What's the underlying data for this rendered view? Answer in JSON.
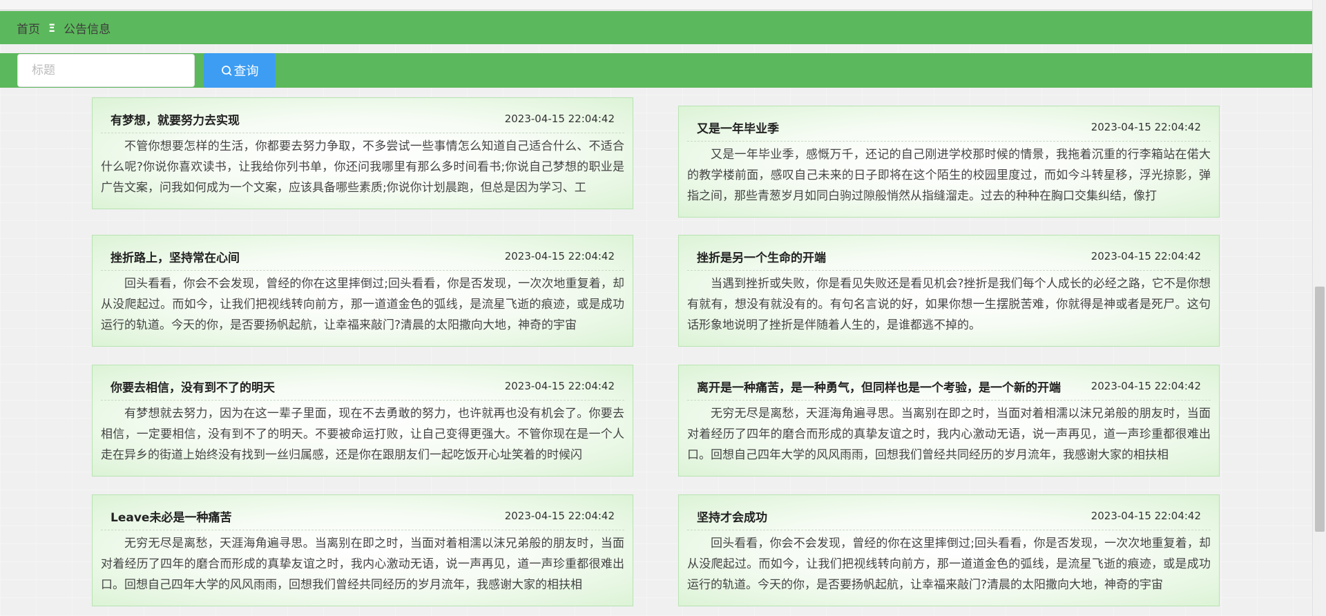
{
  "breadcrumb": {
    "home": "首页",
    "separator": "Ξ",
    "current": "公告信息"
  },
  "search": {
    "placeholder": "标题",
    "value": "",
    "button_label": "查询"
  },
  "colors": {
    "bar_green": "#5cb85c",
    "button_blue": "#3d9df3",
    "card_border": "#b7e3b0"
  },
  "cards": [
    {
      "title": "有梦想，就要努力去实现",
      "time": "2023-04-15 22:04:42",
      "content": "不管你想要怎样的生活，你都要去努力争取，不多尝试一些事情怎么知道自己适合什么、不适合什么呢?你说你喜欢读书，让我给你列书单，你还问我哪里有那么多时间看书;你说自己梦想的职业是广告文案，问我如何成为一个文案，应该具备哪些素质;你说你计划晨跑，但总是因为学习、工"
    },
    {
      "title": "又是一年毕业季",
      "time": "2023-04-15 22:04:42",
      "content": "又是一年毕业季，感慨万千，还记的自己刚进学校那时候的情景，我拖着沉重的行李箱站在偌大的教学楼前面，感叹自己未来的日子即将在这个陌生的校园里度过，而如今斗转星移，浮光掠影，弹指之间，那些青葱岁月如同白驹过隙般悄然从指缝溜走。过去的种种在胸口交集纠结，像打"
    },
    {
      "title": "挫折路上，坚持常在心间",
      "time": "2023-04-15 22:04:42",
      "content": "回头看看，你会不会发现，曾经的你在这里摔倒过;回头看看，你是否发现，一次次地重复着，却从没爬起过。而如今，让我们把视线转向前方，那一道道金色的弧线，是流星飞逝的痕迹，或是成功运行的轨道。今天的你，是否要扬帆起航，让幸福来敲门?清晨的太阳撒向大地，神奇的宇宙"
    },
    {
      "title": "挫折是另一个生命的开端",
      "time": "2023-04-15 22:04:42",
      "content": "当遇到挫折或失败，你是看见失败还是看见机会?挫折是我们每个人成长的必经之路，它不是你想有就有，想没有就没有的。有句名言说的好，如果你想一生摆脱苦难，你就得是神或者是死尸。这句话形象地说明了挫折是伴随着人生的，是谁都逃不掉的。"
    },
    {
      "title": "你要去相信，没有到不了的明天",
      "time": "2023-04-15 22:04:42",
      "content": "有梦想就去努力，因为在这一辈子里面，现在不去勇敢的努力，也许就再也没有机会了。你要去相信，一定要相信，没有到不了的明天。不要被命运打败，让自己变得更强大。不管你现在是一个人走在异乡的街道上始终没有找到一丝归属感，还是你在跟朋友们一起吃饭开心址笑着的时候闪"
    },
    {
      "title": "离开是一种痛苦，是一种勇气，但同样也是一个考验，是一个新的开端",
      "time": "2023-04-15 22:04:42",
      "content": "无穷无尽是离愁，天涯海角遍寻思。当离别在即之时，当面对着相濡以沫兄弟般的朋友时，当面对着经历了四年的磨合而形成的真挚友谊之时，我内心激动无语，说一声再见，道一声珍重都很难出口。回想自己四年大学的风风雨雨，回想我们曾经共同经历的岁月流年，我感谢大家的相扶相"
    },
    {
      "title": "Leave未必是一种痛苦",
      "time": "2023-04-15 22:04:42",
      "content": "无穷无尽是离愁，天涯海角遍寻思。当离别在即之时，当面对着相濡以沫兄弟般的朋友时，当面对着经历了四年的磨合而形成的真挚友谊之时，我内心激动无语，说一声再见，道一声珍重都很难出口。回想自己四年大学的风风雨雨，回想我们曾经共同经历的岁月流年，我感谢大家的相扶相"
    },
    {
      "title": "坚持才会成功",
      "time": "2023-04-15 22:04:42",
      "content": "回头看看，你会不会发现，曾经的你在这里摔倒过;回头看看，你是否发现，一次次地重复着，却从没爬起过。而如今，让我们把视线转向前方，那一道道金色的弧线，是流星飞逝的痕迹，或是成功运行的轨道。今天的你，是否要扬帆起航，让幸福来敲门?清晨的太阳撒向大地，神奇的宇宙"
    }
  ]
}
